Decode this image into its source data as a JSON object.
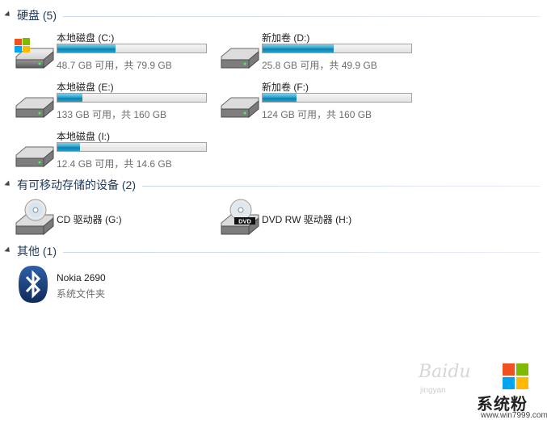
{
  "groups": {
    "hard_disks": {
      "title": "硬盘 (5)"
    },
    "removable": {
      "title": "有可移动存储的设备 (2)"
    },
    "other": {
      "title": "其他 (1)"
    }
  },
  "drives": [
    {
      "name": "本地磁盘 (C:)",
      "info": "48.7 GB 可用，共 79.9 GB",
      "used_fraction": 0.39,
      "system": true
    },
    {
      "name": "新加卷 (D:)",
      "info": "25.8 GB 可用，共 49.9 GB",
      "used_fraction": 0.48
    },
    {
      "name": "本地磁盘 (E:)",
      "info": "133 GB 可用，共 160 GB",
      "used_fraction": 0.17
    },
    {
      "name": "新加卷 (F:)",
      "info": "124 GB 可用，共 160 GB",
      "used_fraction": 0.23
    },
    {
      "name": "本地磁盘 (I:)",
      "info": "12.4 GB 可用，共 14.6 GB",
      "used_fraction": 0.15
    }
  ],
  "removable": [
    {
      "name": "CD 驱动器 (G:)",
      "icon": "cd-drive-icon"
    },
    {
      "name": "DVD RW 驱动器 (H:)",
      "icon": "dvd-drive-icon",
      "icon_label": "DVD"
    }
  ],
  "other": [
    {
      "name": "Nokia 2690",
      "sub": "系统文件夹",
      "icon": "bluetooth-icon"
    }
  ],
  "watermark": {
    "baidu": "Baidu",
    "baidu_sub": "jingyan",
    "brand": "系统粉",
    "url": "www.win7999.com"
  },
  "colors": {
    "header_text": "#1e395b",
    "bar_fill": "#1a8fc0",
    "info_text": "#6d6d6d"
  }
}
